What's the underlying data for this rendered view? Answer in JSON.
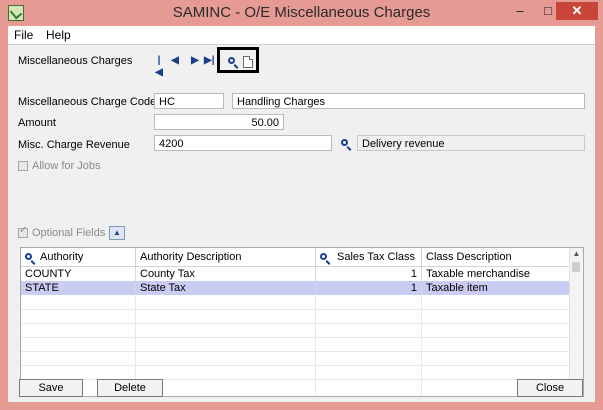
{
  "window": {
    "title": "SAMINC - O/E Miscellaneous Charges",
    "min": "–",
    "max": "□",
    "close": "✕"
  },
  "menu": {
    "file": "File",
    "help": "Help"
  },
  "nav": {
    "label": "Miscellaneous Charges",
    "first": "|◀",
    "prev": "◀",
    "next": "▶",
    "last": "▶|"
  },
  "form": {
    "code_label": "Miscellaneous Charge Code",
    "code_value": "HC",
    "code_desc": "Handling Charges",
    "amount_label": "Amount",
    "amount_value": "50.00",
    "revenue_label": "Misc. Charge Revenue",
    "revenue_value": "4200",
    "revenue_desc": "Delivery revenue",
    "allow_jobs_label": "Allow for Jobs",
    "optional_fields_label": "Optional Fields"
  },
  "grid": {
    "headers": {
      "authority": "Authority",
      "authority_desc": "Authority Description",
      "tax_class": "Sales Tax Class",
      "class_desc": "Class Description"
    },
    "rows": [
      {
        "authority": "COUNTY",
        "authority_desc": "County Tax",
        "tax_class": "1",
        "class_desc": "Taxable merchandise"
      },
      {
        "authority": "STATE",
        "authority_desc": "State Tax",
        "tax_class": "1",
        "class_desc": "Taxable item"
      }
    ]
  },
  "buttons": {
    "save": "Save",
    "delete": "Delete",
    "close": "Close"
  },
  "colors": {
    "window_frame": "#e59a93",
    "selected_row": "#c9ccf3",
    "accent": "#1a3f8a"
  }
}
